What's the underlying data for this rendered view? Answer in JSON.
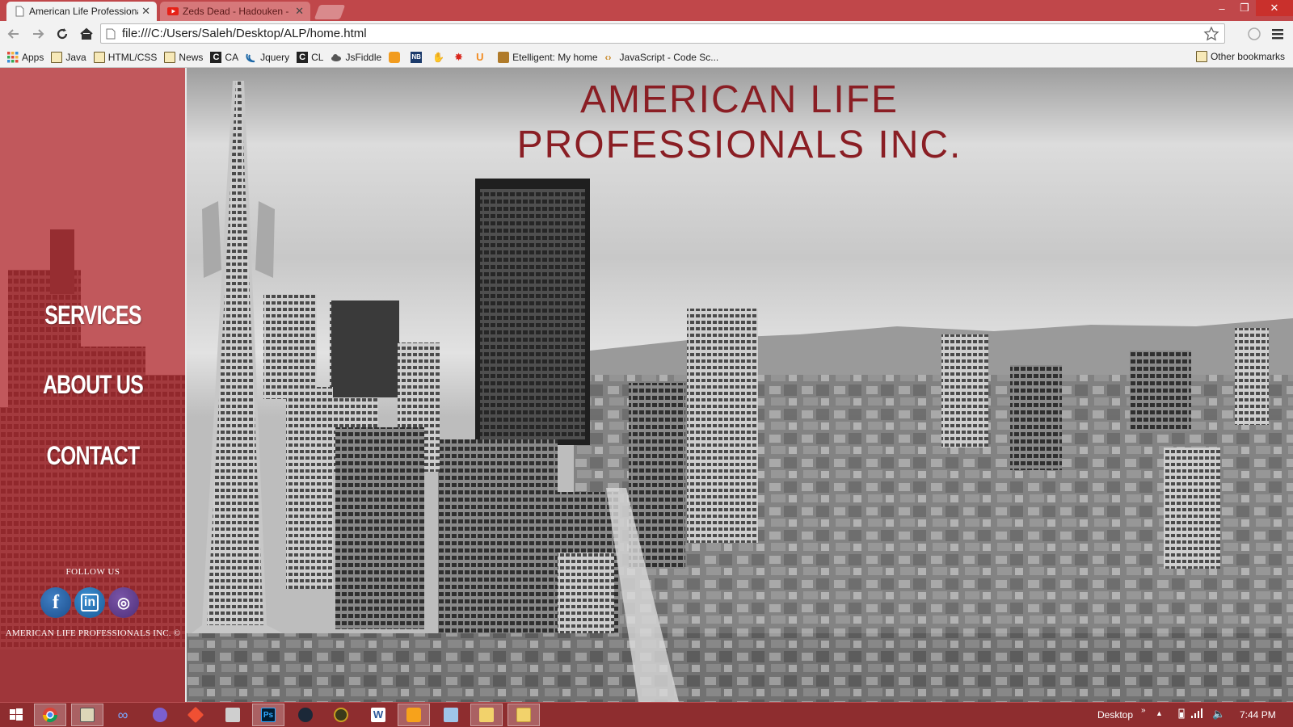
{
  "browser": {
    "tabs": [
      {
        "title": "American Life Professiona",
        "active": true
      },
      {
        "title": "Zeds Dead - Hadouken - Y",
        "active": false
      }
    ],
    "url": "file:///C:/Users/Saleh/Desktop/ALP/home.html",
    "bookmarks": [
      {
        "label": "Apps",
        "icon": "apps-grid-icon"
      },
      {
        "label": "Java",
        "icon": "folder-icon"
      },
      {
        "label": "HTML/CSS",
        "icon": "folder-icon"
      },
      {
        "label": "News",
        "icon": "folder-icon"
      },
      {
        "label": "CA",
        "icon": "codecademy-icon"
      },
      {
        "label": "Jquery",
        "icon": "jquery-icon"
      },
      {
        "label": "CL",
        "icon": "codecademy-icon"
      },
      {
        "label": "JsFiddle",
        "icon": "cloud-icon"
      },
      {
        "label": "",
        "icon": "orange-app-icon"
      },
      {
        "label": "",
        "icon": "nb-icon"
      },
      {
        "label": "",
        "icon": "hand-icon"
      },
      {
        "label": "",
        "icon": "red-splash-icon"
      },
      {
        "label": "",
        "icon": "u-icon"
      },
      {
        "label": "Etelligent: My home",
        "icon": "etelligent-icon"
      },
      {
        "label": "JavaScript - Code Sc...",
        "icon": "code-icon"
      }
    ],
    "other_bookmarks": "Other bookmarks"
  },
  "site": {
    "title_line1": "AMERICAN LIFE",
    "title_line2": "PROFESSIONALS INC.",
    "nav": [
      "SERVICES",
      "ABOUT US",
      "CONTACT"
    ],
    "follow_label": "FOLLOW US",
    "social": [
      {
        "name": "facebook",
        "glyph": "f"
      },
      {
        "name": "linkedin",
        "glyph": "in"
      },
      {
        "name": "instagram",
        "glyph": "◎"
      }
    ],
    "copyright": "AMERICAN LIFE PROFESSIONALS INC. ©",
    "colors": {
      "accent": "#c0474a",
      "title": "#8a1e24",
      "sidebar_tint": "#ba282e"
    }
  },
  "taskbar": {
    "desktop_label": "Desktop",
    "clock": "7:44 PM"
  }
}
